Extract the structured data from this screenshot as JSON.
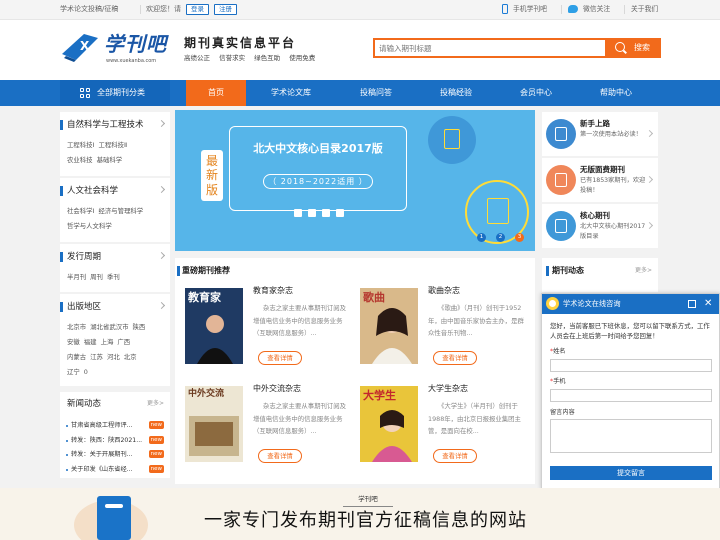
{
  "topbar": {
    "left_link": "学术论文投稿/征稿",
    "welcome": "欢迎您！请",
    "login": "登录",
    "register": "注册",
    "mobile": "手机学刊吧",
    "wechat": "微信关注",
    "about": "关于我们"
  },
  "header": {
    "logo_text": "学刊吧",
    "logo_url": "www.xuekanba.com",
    "slogan": "期刊真实信息平台",
    "slogan_tags": [
      "高绩公正",
      "信誉求实",
      "绿色互助",
      "使用免费"
    ],
    "search_placeholder": "请输入期刊标题",
    "search_button": "搜索"
  },
  "nav": {
    "all_categories": "全部期刊分类",
    "items": [
      "首页",
      "学术论文库",
      "投稿问答",
      "投稿经验",
      "会员中心",
      "帮助中心"
    ]
  },
  "categories": [
    {
      "title": "自然科学与工程技术",
      "links": [
        "工程科技I",
        "工程科技Ⅱ",
        "农业科技",
        "基础科学"
      ]
    },
    {
      "title": "人文社会科学",
      "links": [
        "社会科学I",
        "经济与管理科学",
        "哲学与人文科学"
      ]
    },
    {
      "title": "发行周期",
      "links": [
        "半月刊",
        "周刊",
        "季刊"
      ]
    },
    {
      "title": "出版地区",
      "links": [
        "北京市",
        "湖北省武汉市",
        "陕西",
        "安徽",
        "福建",
        "上海",
        "广西",
        "内蒙古",
        "江苏",
        "河北",
        "北京",
        "辽宁",
        "0"
      ]
    }
  ],
  "news": {
    "title": "新闻动态",
    "more": "更多>",
    "items": [
      {
        "text": "甘肃省高级工程师评...",
        "badge": "new"
      },
      {
        "text": "陕西：陕西2021...",
        "badge": "new",
        "prefix": "转发："
      },
      {
        "text": "关于开展期刊...",
        "badge": "new",
        "prefix": "转发："
      },
      {
        "text": "关于印发《山东省经...",
        "badge": "new"
      }
    ]
  },
  "banner": {
    "side_word": [
      "最",
      "新",
      "版"
    ],
    "title": "北大中文核心目录2017版",
    "years": "（ 2018~2022适用 ）",
    "pager": [
      "1",
      "2",
      "3"
    ]
  },
  "promos": [
    {
      "title": "新手上路",
      "desc": "第一次使用本站必读！",
      "color": "#3d8ad0"
    },
    {
      "title": "无版面费期刊",
      "desc": "已有1853家期刊，欢迎投稿！",
      "color": "#f0875a"
    },
    {
      "title": "核心期刊",
      "desc": "北大中文核心期刊2017版目录",
      "color": "#3f98d8"
    }
  ],
  "featured": {
    "title": "重磅期刊推荐",
    "button": "查看详情",
    "journals": [
      {
        "name": "教育家杂志",
        "desc": "杂志之家主要从事期刊订阅及增值电信业务中的信息服务业务（互联网信息服务）...",
        "cover": "教育家",
        "cover_color": "#1f3a63"
      },
      {
        "name": "歌曲杂志",
        "desc": "《歌曲》（月刊）创刊于1952年，由中国音乐家协会主办，是群众性音乐刊物...",
        "cover": "歌曲",
        "cover_color": "#d9b98a"
      },
      {
        "name": "中外交流杂志",
        "desc": "杂志之家主要从事期刊订阅及增值电信业务中的信息服务业务（互联网信息服务）...",
        "cover": "中外交流",
        "cover_color": "#ede6d3"
      },
      {
        "name": "大学生杂志",
        "desc": "《大学生》（半月刊）创刊于1988年，由北京日报报业集团主管，是面向在校...",
        "cover": "大学生",
        "cover_color": "#e9c53a"
      }
    ]
  },
  "dynamics": {
    "title": "期刊动态",
    "more": "更多>"
  },
  "consult": {
    "title": "学术论文在线咨询",
    "message": "您好，当前客服已下班休息，您可以留下联系方式，工作人员会在上班后第一时间给予您回复！",
    "name_label": "姓名",
    "phone_label": "手机",
    "content_label": "留言内容",
    "submit": "提交留言",
    "close": "✕"
  },
  "bottom": {
    "small": "学刊吧",
    "big": "一家专门发布期刊官方征稿信息的网站"
  },
  "colors": {
    "brand_blue": "#1a6fc4",
    "accent_orange": "#f26a1b",
    "banner_blue": "#56b5e9"
  }
}
